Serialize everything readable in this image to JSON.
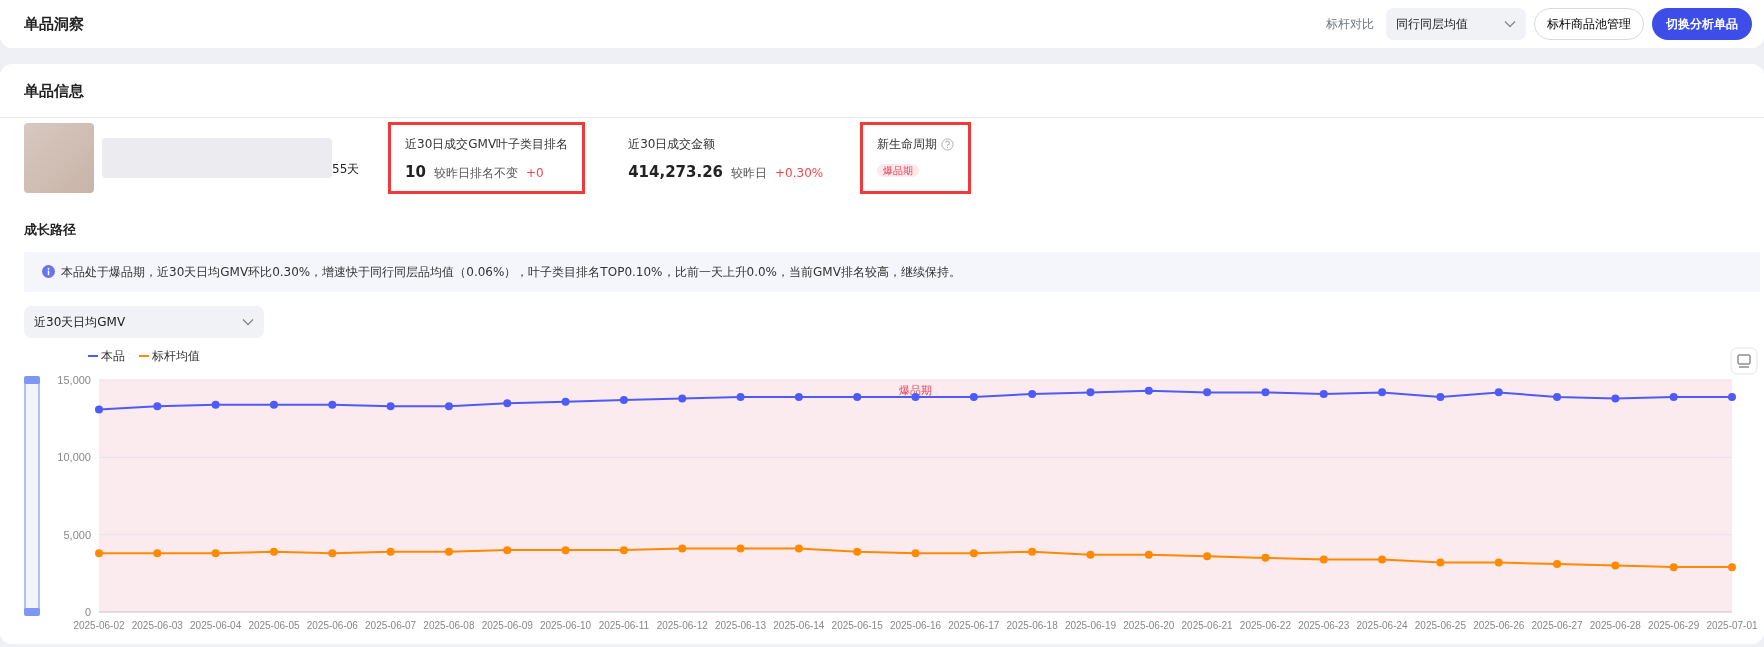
{
  "header": {
    "title": "单品洞察",
    "benchmark_label": "标杆对比",
    "benchmark_select": {
      "value": "同行同层均值"
    },
    "buttons": [
      {
        "label": "标杆商品池管理",
        "kind": "outline"
      },
      {
        "label": "切换分析单品",
        "kind": "primary"
      }
    ]
  },
  "info": {
    "title": "单品信息",
    "product": {
      "days_text": "55天"
    },
    "metrics": [
      {
        "kind": "stat",
        "label": "近30日成交GMV叶子类目排名",
        "value": "10",
        "compare_label": "较昨日排名不变",
        "change": "+0",
        "highlighted": true
      },
      {
        "kind": "stat",
        "label": "近30日成交金额",
        "value": "414,273.26",
        "compare_label": "较昨日",
        "change": "+0.30%",
        "highlighted": false
      },
      {
        "kind": "tag",
        "label": "新生命周期",
        "tag": "爆品期",
        "highlighted": true
      }
    ]
  },
  "growth": {
    "title": "成长路径",
    "summary": "本品处于爆品期，近30天日均GMV环比0.30%，增速快于同行同层品均值（0.06%），叶子类目排名TOP0.10%，比前一天上升0.0%，当前GMV排名较高，继续保持。",
    "metric_select": {
      "value": "近30天日均GMV"
    },
    "chart_data": {
      "type": "line",
      "categories": [
        "2025-06-02",
        "2025-06-03",
        "2025-06-04",
        "2025-06-05",
        "2025-06-06",
        "2025-06-07",
        "2025-06-08",
        "2025-06-09",
        "2025-06-10",
        "2025-06-11",
        "2025-06-12",
        "2025-06-13",
        "2025-06-14",
        "2025-06-15",
        "2025-06-16",
        "2025-06-17",
        "2025-06-18",
        "2025-06-19",
        "2025-06-20",
        "2025-06-21",
        "2025-06-22",
        "2025-06-23",
        "2025-06-24",
        "2025-06-25",
        "2025-06-26",
        "2025-06-27",
        "2025-06-28",
        "2025-06-29",
        "2025-07-01"
      ],
      "legend": true,
      "ylim": [
        0,
        15000
      ],
      "yticks": [
        {
          "value": 0,
          "label": "0"
        },
        {
          "value": 5000,
          "label": "5,000"
        },
        {
          "value": 10000,
          "label": "10,000"
        },
        {
          "value": 15000,
          "label": "15,000"
        }
      ],
      "series": [
        {
          "name": "本品",
          "color": "#4f5bf6",
          "marker": "circle",
          "values": [
            13100,
            13300,
            13400,
            13400,
            13400,
            13300,
            13300,
            13500,
            13600,
            13700,
            13800,
            13900,
            13900,
            13900,
            13900,
            13900,
            14100,
            14200,
            14300,
            14200,
            14200,
            14100,
            14200,
            13900,
            14200,
            13900,
            13800,
            13900,
            13900
          ]
        },
        {
          "name": "标杆均值",
          "color": "#ff8a00",
          "marker": "circle",
          "values": [
            3800,
            3800,
            3800,
            3900,
            3800,
            3900,
            3900,
            4000,
            4000,
            4000,
            4100,
            4100,
            4100,
            3900,
            3800,
            3800,
            3900,
            3700,
            3700,
            3600,
            3500,
            3400,
            3400,
            3200,
            3200,
            3100,
            3000,
            2900,
            2900
          ]
        }
      ],
      "annotations": [
        {
          "text": "爆品期"
        }
      ]
    }
  }
}
